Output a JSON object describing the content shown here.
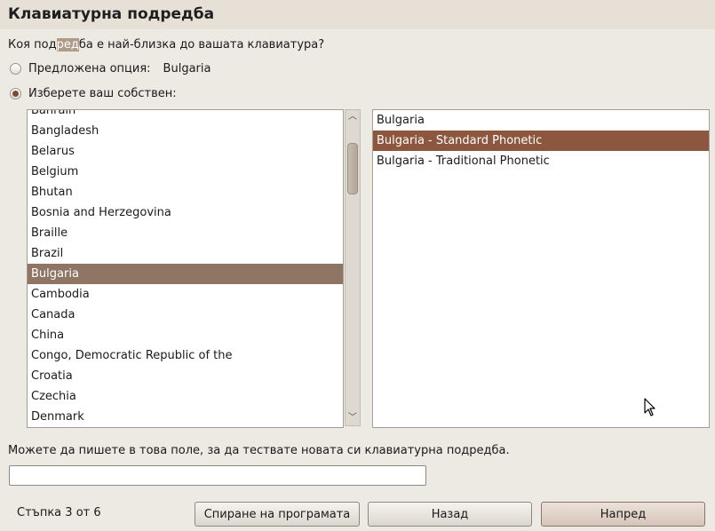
{
  "header": {
    "title": "Клавиатурна подредба"
  },
  "question": {
    "before": "Коя под",
    "selected": "ред",
    "after": "ба е най-близка до вашата клавиатура?"
  },
  "options": {
    "suggested_label": "Предложена опция:",
    "suggested_value": "Bulgaria",
    "custom_label": "Изберете ваш собствен:",
    "selected": "custom"
  },
  "countries": {
    "items": [
      "Bahrain",
      "Bangladesh",
      "Belarus",
      "Belgium",
      "Bhutan",
      "Bosnia and Herzegovina",
      "Braille",
      "Brazil",
      "Bulgaria",
      "Cambodia",
      "Canada",
      "China",
      "Congo, Democratic Republic of the",
      "Croatia",
      "Czechia",
      "Denmark"
    ],
    "selected": "Bulgaria"
  },
  "variants": {
    "items": [
      "Bulgaria",
      "Bulgaria - Standard Phonetic",
      "Bulgaria - Traditional Phonetic"
    ],
    "selected": "Bulgaria - Standard Phonetic"
  },
  "test": {
    "label": "Можете да пишете в това поле, за да тествате новата си клавиатурна подредба.",
    "value": ""
  },
  "footer": {
    "step": "Стъпка 3 от 6",
    "quit_label": "Спиране на програмата",
    "back_label": "Назад",
    "forward_label": "Напред"
  },
  "icons": {
    "scroll_up": "chevron-up-icon",
    "scroll_down": "chevron-down-icon",
    "cursor": "mouse-pointer-icon"
  },
  "colors": {
    "window_bg": "#ede9e3",
    "country_selection": "#8e7564",
    "variant_selection": "#8d563f",
    "radio_dot": "#7a4a32"
  }
}
